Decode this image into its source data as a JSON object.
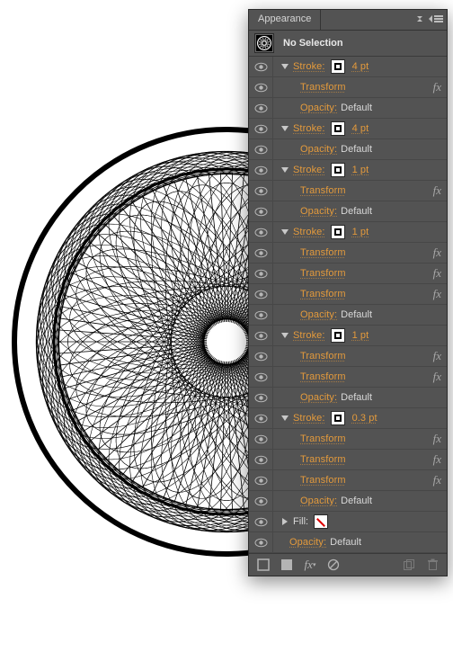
{
  "panel": {
    "title": "Appearance",
    "selection_label": "No Selection",
    "footer": {
      "new_stroke": "new-stroke",
      "new_fill": "new-fill",
      "fx": "fx",
      "clear": "clear",
      "duplicate": "duplicate",
      "trash": "trash"
    }
  },
  "rows": [
    {
      "type": "stroke_header",
      "label": "Stroke:",
      "weight": "4 pt"
    },
    {
      "type": "child",
      "label": "Transform",
      "fx": true
    },
    {
      "type": "child",
      "label": "Opacity:",
      "value": "Default"
    },
    {
      "type": "stroke_header",
      "label": "Stroke:",
      "weight": "4 pt"
    },
    {
      "type": "child",
      "label": "Opacity:",
      "value": "Default"
    },
    {
      "type": "stroke_header",
      "label": "Stroke:",
      "weight": "1 pt"
    },
    {
      "type": "child",
      "label": "Transform",
      "fx": true
    },
    {
      "type": "child",
      "label": "Opacity:",
      "value": "Default"
    },
    {
      "type": "stroke_header",
      "label": "Stroke:",
      "weight": "1 pt"
    },
    {
      "type": "child",
      "label": "Transform",
      "fx": true
    },
    {
      "type": "child",
      "label": "Transform",
      "fx": true
    },
    {
      "type": "child",
      "label": "Transform",
      "fx": true
    },
    {
      "type": "child",
      "label": "Opacity:",
      "value": "Default"
    },
    {
      "type": "stroke_header",
      "label": "Stroke:",
      "weight": "1 pt"
    },
    {
      "type": "child",
      "label": "Transform",
      "fx": true
    },
    {
      "type": "child",
      "label": "Transform",
      "fx": true
    },
    {
      "type": "child",
      "label": "Opacity:",
      "value": "Default"
    },
    {
      "type": "stroke_header",
      "label": "Stroke:",
      "weight": "0.3 pt"
    },
    {
      "type": "child",
      "label": "Transform",
      "fx": true
    },
    {
      "type": "child",
      "label": "Transform",
      "fx": true
    },
    {
      "type": "child",
      "label": "Transform",
      "fx": true
    },
    {
      "type": "child",
      "label": "Opacity:",
      "value": "Default"
    },
    {
      "type": "fill_header",
      "label": "Fill:"
    },
    {
      "type": "root_child",
      "label": "Opacity:",
      "value": "Default"
    }
  ]
}
